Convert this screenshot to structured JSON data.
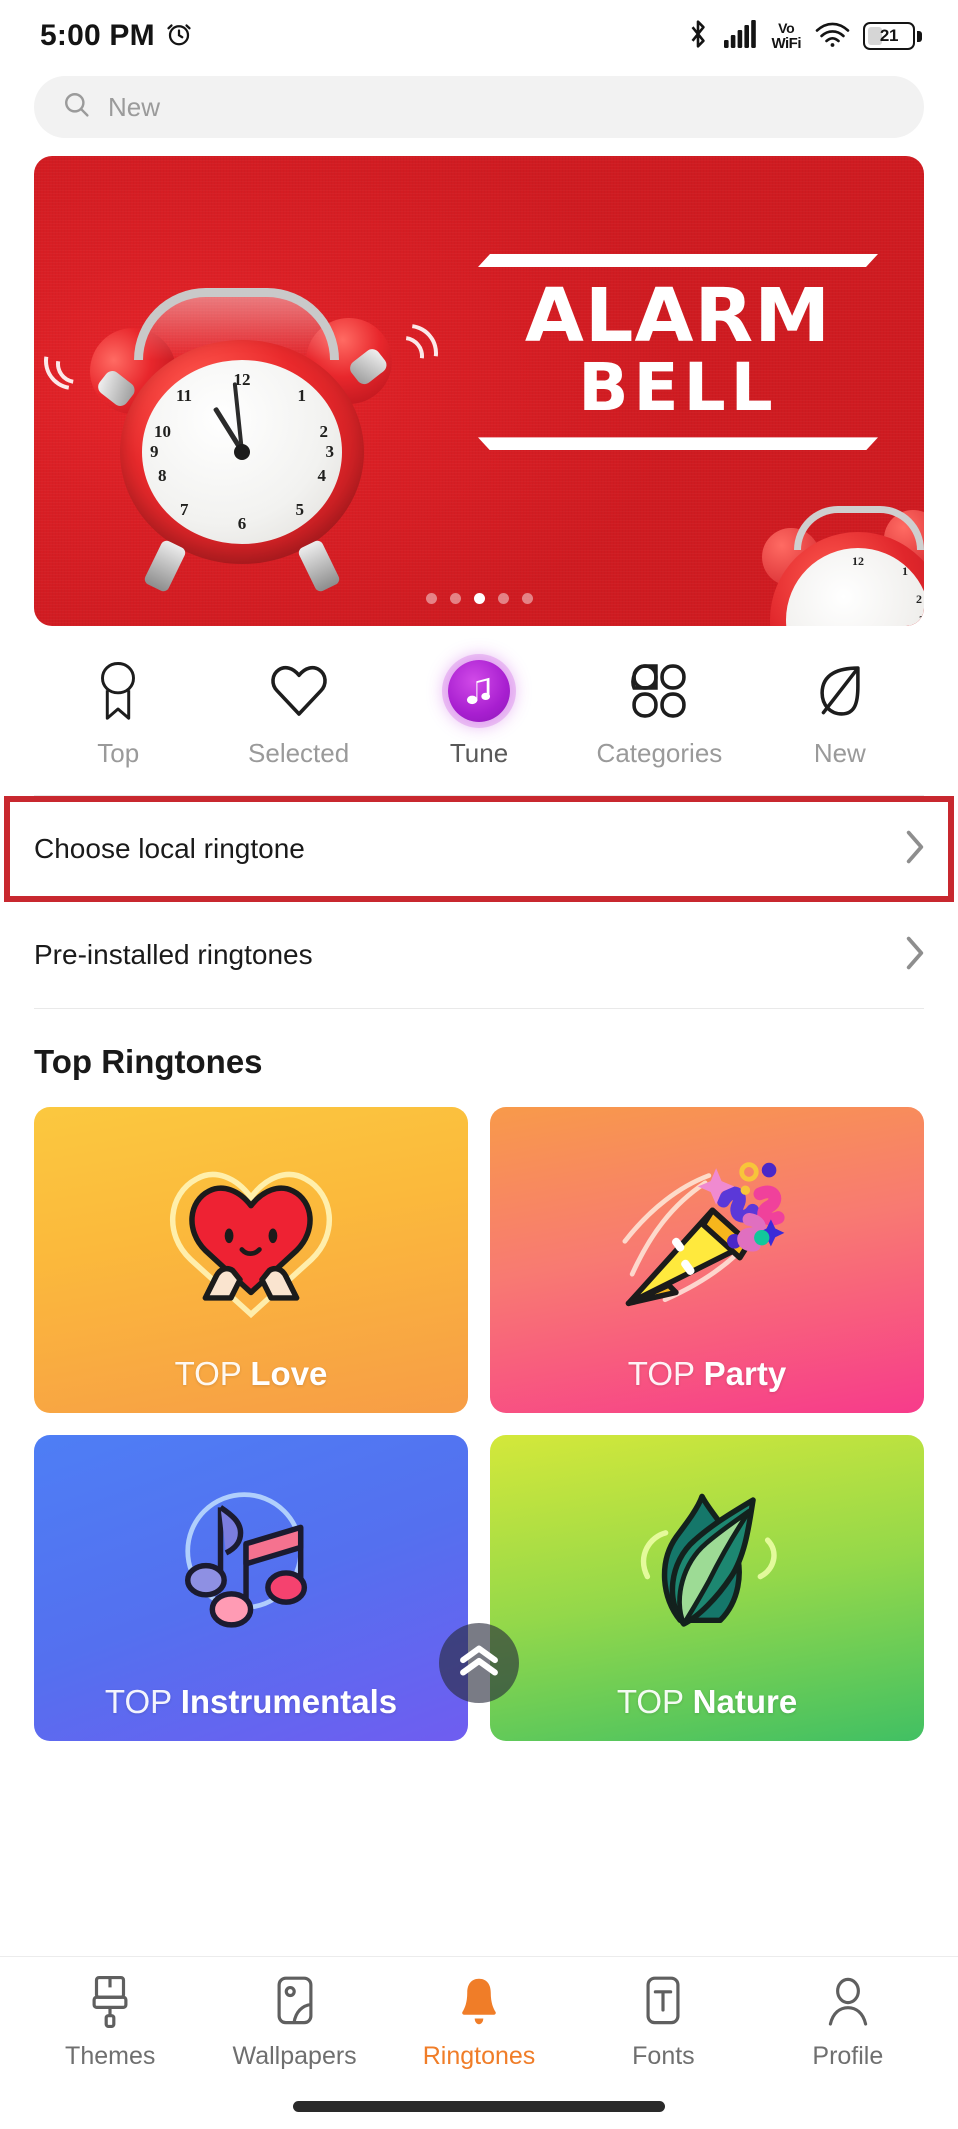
{
  "status_bar": {
    "time": "5:00 PM",
    "alarm_icon": "alarm-clock-icon",
    "bluetooth_icon": "bluetooth-icon",
    "signal_icon": "cellular-signal-icon",
    "vowifi_top": "Vo",
    "vowifi_bottom": "WiFi",
    "wifi_icon": "wifi-icon",
    "battery_level": "21"
  },
  "search": {
    "placeholder": "New",
    "icon": "search-icon"
  },
  "banner": {
    "title_line1": "ALARM",
    "title_line2": "BELL",
    "background_color": "#da1f25",
    "total_slides": 5,
    "active_slide": 3,
    "clock_numbers": [
      "12",
      "1",
      "2",
      "3",
      "4",
      "5",
      "6",
      "7",
      "8",
      "9",
      "10",
      "11"
    ]
  },
  "categories": [
    {
      "label": "Top",
      "icon": "ribbon-badge-icon",
      "active": false
    },
    {
      "label": "Selected",
      "icon": "heart-icon",
      "active": false
    },
    {
      "label": "Tune",
      "icon": "music-note-icon",
      "active": true
    },
    {
      "label": "Categories",
      "icon": "four-petal-grid-icon",
      "active": false
    },
    {
      "label": "New",
      "icon": "leaf-icon",
      "active": false
    }
  ],
  "list_rows": [
    {
      "label": "Choose local ringtone",
      "chevron": "chevron-right-icon",
      "highlighted": true
    },
    {
      "label": "Pre-installed ringtones",
      "chevron": "chevron-right-icon",
      "highlighted": false
    }
  ],
  "highlight_color": "#c8282f",
  "top_ringtones": {
    "section_title": "Top Ringtones",
    "cards": [
      {
        "prefix": "TOP",
        "name": "Love",
        "art": "smiling-heart-icon",
        "gradient_from": "#fbc83f",
        "gradient_to": "#f79d46"
      },
      {
        "prefix": "TOP",
        "name": "Party",
        "art": "party-popper-icon",
        "gradient_from": "#f89a4a",
        "gradient_to": "#f73b8b"
      },
      {
        "prefix": "TOP",
        "name": "Instrumentals",
        "art": "double-music-note-icon",
        "gradient_from": "#4e7ef5",
        "gradient_to": "#6f5df0"
      },
      {
        "prefix": "TOP",
        "name": "Nature",
        "art": "two-leaves-icon",
        "gradient_from": "#d4e83a",
        "gradient_to": "#41c063"
      }
    ]
  },
  "scroll_top_button": {
    "icon": "double-chevron-up-icon"
  },
  "bottom_nav": {
    "active_color": "#f07d28",
    "items": [
      {
        "label": "Themes",
        "icon": "paint-roller-icon",
        "active": false
      },
      {
        "label": "Wallpapers",
        "icon": "wallpaper-image-icon",
        "active": false
      },
      {
        "label": "Ringtones",
        "icon": "bell-icon",
        "active": true
      },
      {
        "label": "Fonts",
        "icon": "font-t-icon",
        "active": false
      },
      {
        "label": "Profile",
        "icon": "person-icon",
        "active": false
      }
    ]
  }
}
